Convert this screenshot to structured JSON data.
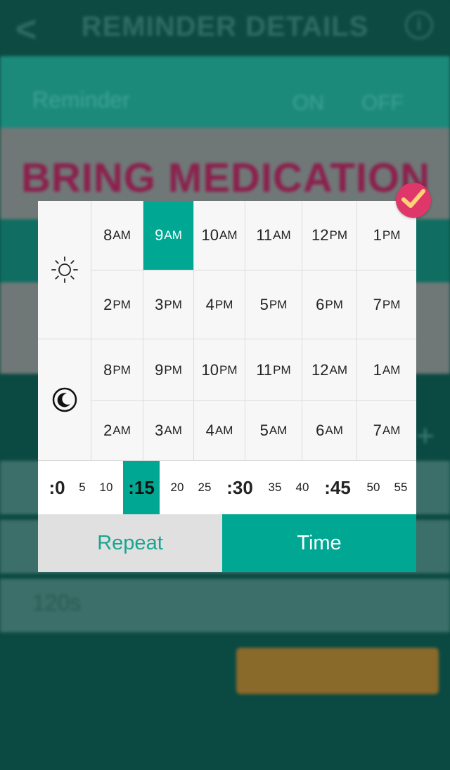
{
  "background": {
    "header_title": "REMINDER DETAILS",
    "back_glyph": "<",
    "info_glyph": "i",
    "reminder_label": "Reminder",
    "on_label": "ON",
    "off_label": "OFF",
    "reminder_name": "BRING MEDICATION",
    "field_value": "120s"
  },
  "picker": {
    "day_icon": "sun-icon",
    "night_icon": "moon-icon",
    "day_hours": [
      [
        {
          "n": "8",
          "s": "AM"
        },
        {
          "n": "9",
          "s": "AM"
        },
        {
          "n": "10",
          "s": "AM"
        },
        {
          "n": "11",
          "s": "AM"
        },
        {
          "n": "12",
          "s": "PM"
        },
        {
          "n": "1",
          "s": "PM"
        }
      ],
      [
        {
          "n": "2",
          "s": "PM"
        },
        {
          "n": "3",
          "s": "PM"
        },
        {
          "n": "4",
          "s": "PM"
        },
        {
          "n": "5",
          "s": "PM"
        },
        {
          "n": "6",
          "s": "PM"
        },
        {
          "n": "7",
          "s": "PM"
        }
      ]
    ],
    "night_hours": [
      [
        {
          "n": "8",
          "s": "PM"
        },
        {
          "n": "9",
          "s": "PM"
        },
        {
          "n": "10",
          "s": "PM"
        },
        {
          "n": "11",
          "s": "PM"
        },
        {
          "n": "12",
          "s": "AM"
        },
        {
          "n": "1",
          "s": "AM"
        }
      ],
      [
        {
          "n": "2",
          "s": "AM"
        },
        {
          "n": "3",
          "s": "AM"
        },
        {
          "n": "4",
          "s": "AM"
        },
        {
          "n": "5",
          "s": "AM"
        },
        {
          "n": "6",
          "s": "AM"
        },
        {
          "n": "7",
          "s": "AM"
        }
      ]
    ],
    "selected_hour": "9AM",
    "minutes": [
      ":0",
      "5",
      "10",
      ":15",
      "20",
      "25",
      ":30",
      "35",
      "40",
      ":45",
      "50",
      "55"
    ],
    "selected_minute": ":15",
    "tabs": {
      "repeat": "Repeat",
      "time": "Time"
    },
    "active_tab": "Time",
    "confirm_icon": "check-icon",
    "accent_color": "#00a893",
    "confirm_color": "#e0376b"
  }
}
